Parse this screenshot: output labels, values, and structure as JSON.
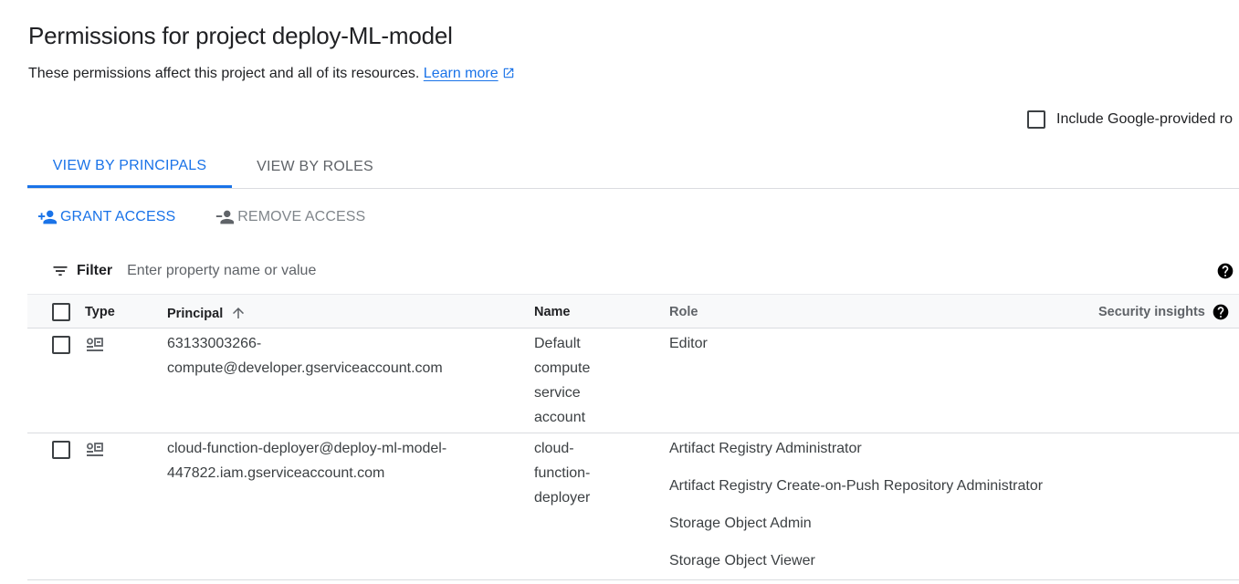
{
  "page": {
    "title": "Permissions for project deploy-ML-model",
    "subtitle": "These permissions affect this project and all of its resources.",
    "learn_more": "Learn more"
  },
  "include_google_roles": {
    "label": "Include Google-provided ro",
    "checked": false
  },
  "tabs": [
    {
      "label": "VIEW BY PRINCIPALS",
      "active": true
    },
    {
      "label": "VIEW BY ROLES",
      "active": false
    }
  ],
  "actions": {
    "grant": "GRANT ACCESS",
    "remove": "REMOVE ACCESS"
  },
  "filter": {
    "label": "Filter",
    "placeholder": "Enter property name or value"
  },
  "table": {
    "headers": {
      "type": "Type",
      "principal": "Principal",
      "name": "Name",
      "role": "Role",
      "security": "Security insights"
    },
    "rows": [
      {
        "type_icon": "service-account-icon",
        "principal_line1": "63133003266-",
        "principal_line2": "compute@developer.gserviceaccount.com",
        "name_lines": [
          "Default",
          "compute",
          "service",
          "account"
        ],
        "roles": [
          "Editor"
        ]
      },
      {
        "type_icon": "service-account-icon",
        "principal_line1": "cloud-function-deployer@deploy-ml-model-",
        "principal_line2": "447822.iam.gserviceaccount.com",
        "name_lines": [
          "cloud-",
          "function-",
          "deployer"
        ],
        "roles": [
          "Artifact Registry Administrator",
          "Artifact Registry Create-on-Push Repository Administrator",
          "Storage Object Admin",
          "Storage Object Viewer"
        ]
      }
    ]
  },
  "colors": {
    "accent": "#1a73e8",
    "text": "#202124",
    "muted": "#5f6368",
    "border": "#dadce0"
  }
}
